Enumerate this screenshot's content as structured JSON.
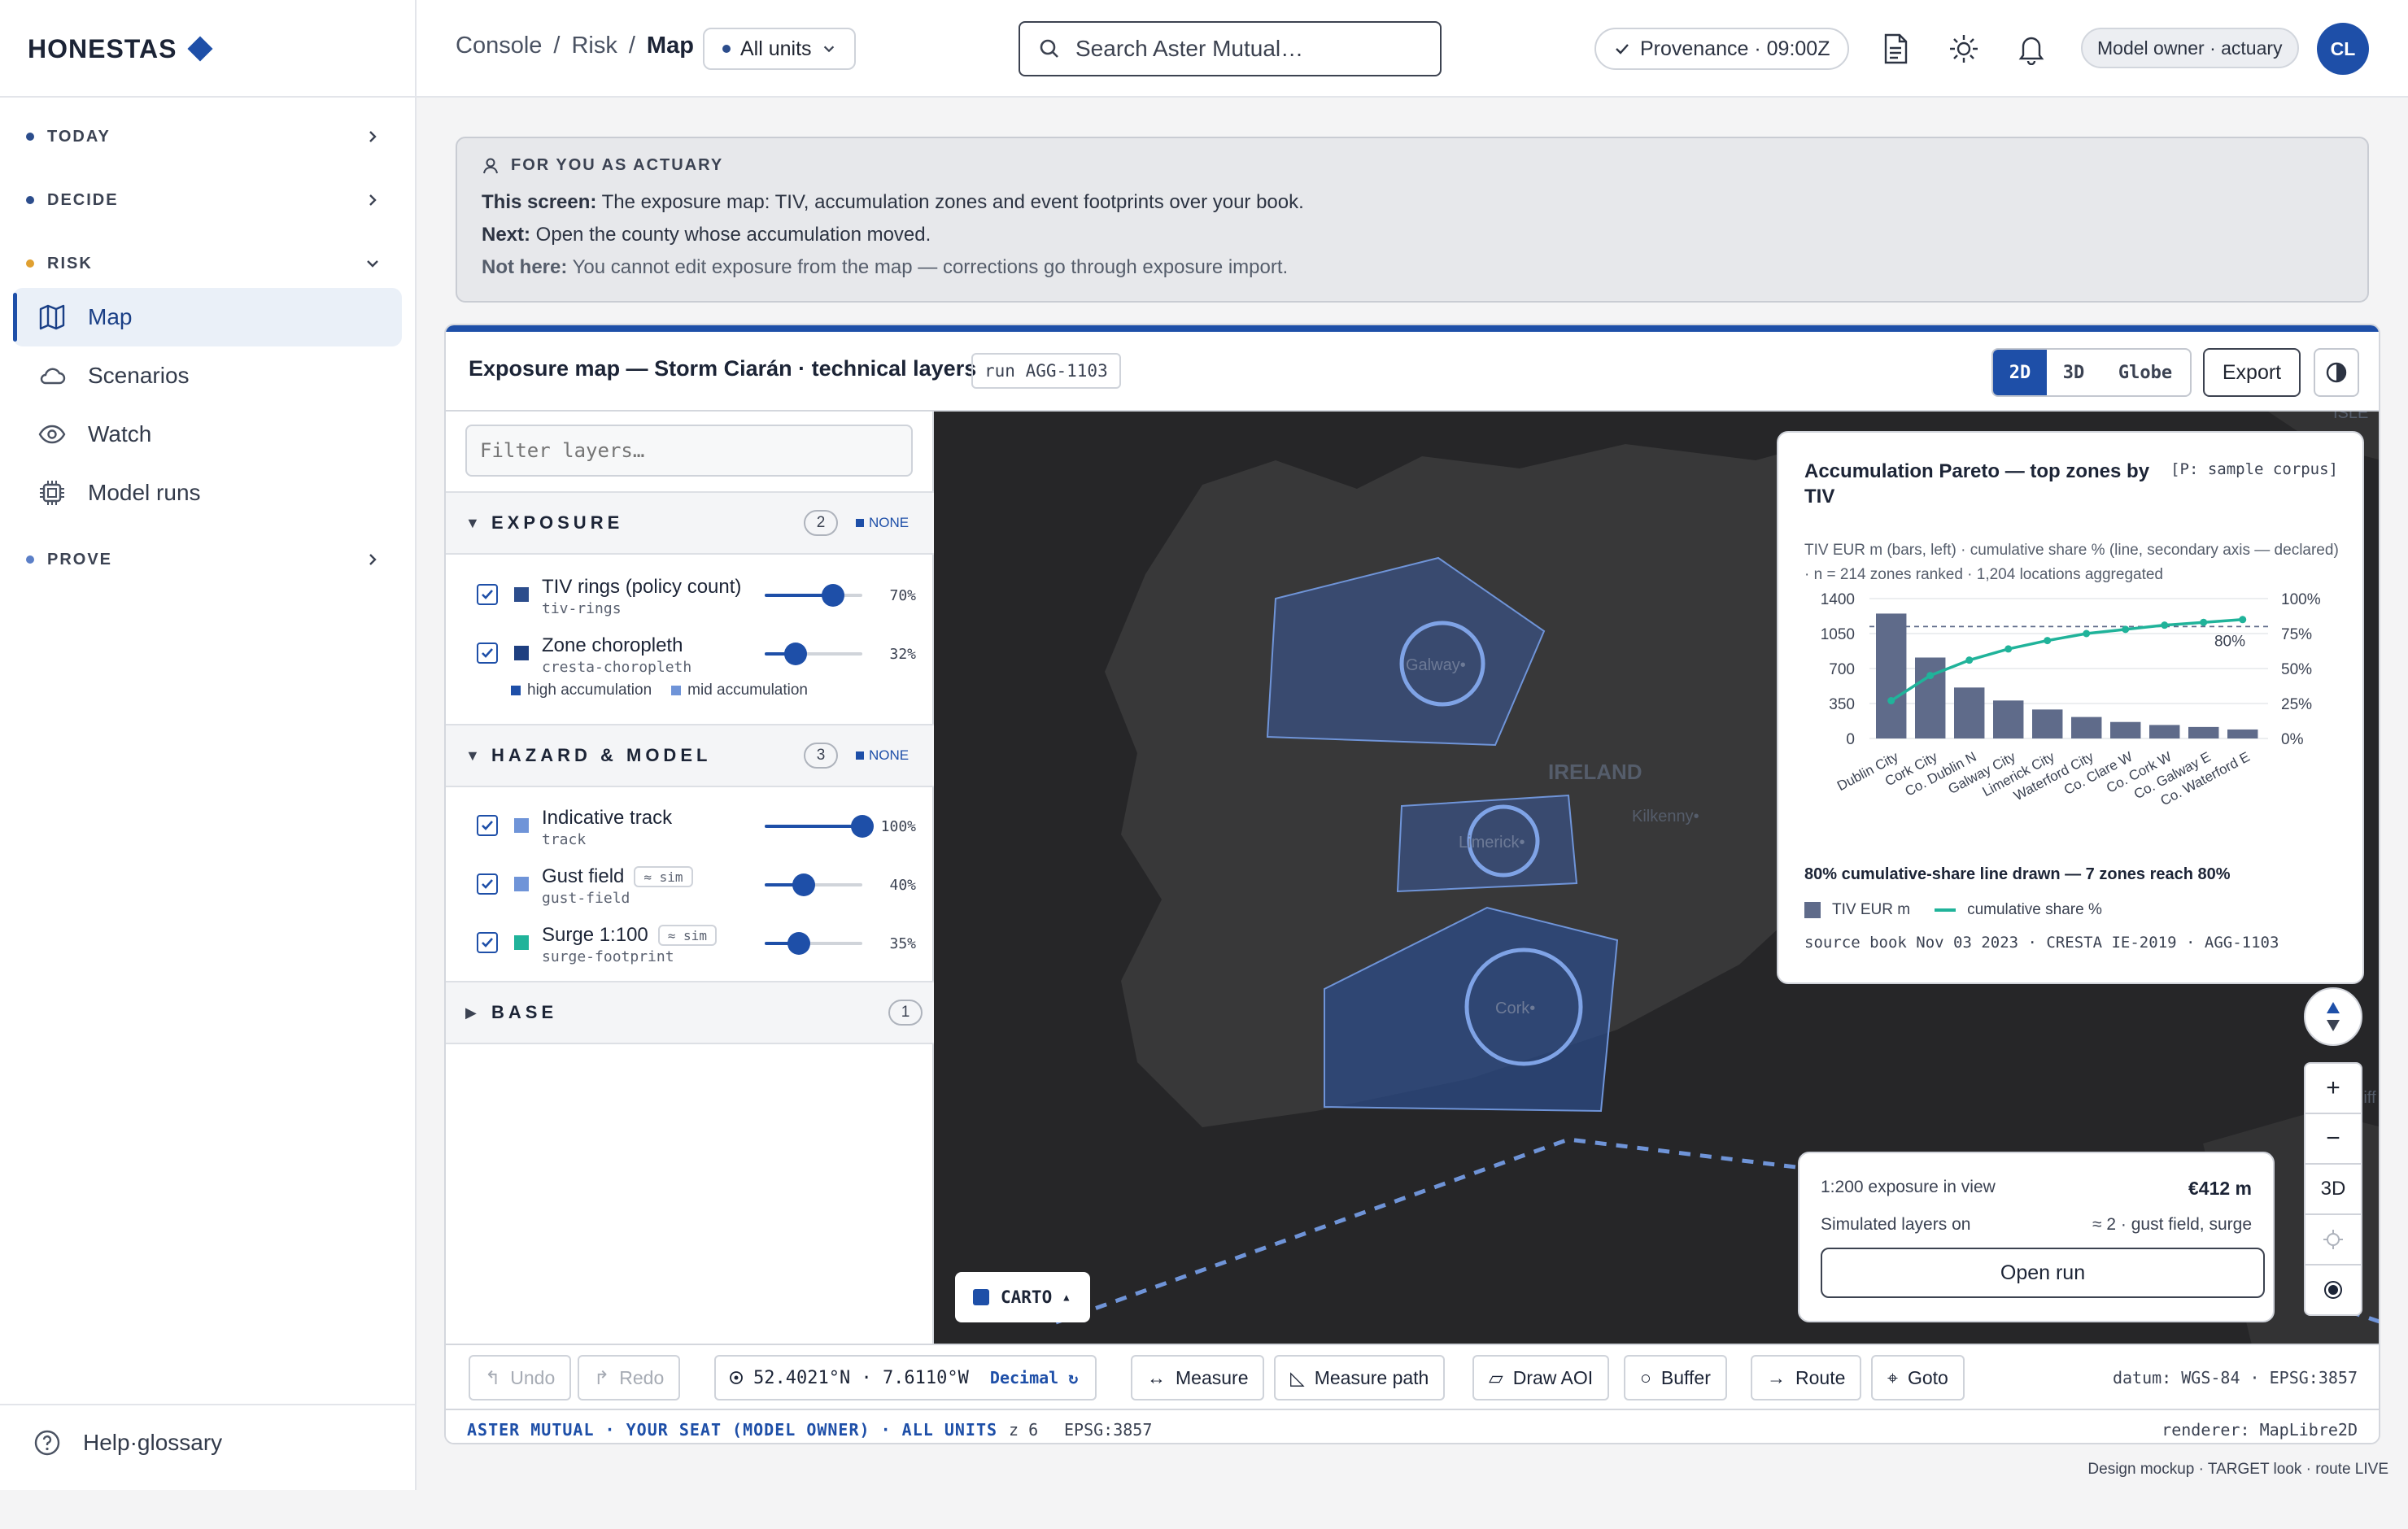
{
  "brand": {
    "name": "HONESTAS"
  },
  "sidebar": {
    "sections": [
      {
        "label": "TODAY",
        "dot_color": "#2c4d8c"
      },
      {
        "label": "DECIDE",
        "dot_color": "#2c4d8c"
      },
      {
        "label": "RISK",
        "dot_color": "#e0a030"
      },
      {
        "label": "PROVE",
        "dot_color": "#5b7fc7"
      }
    ],
    "items": [
      {
        "label": "Map",
        "icon": "map-icon",
        "active": true
      },
      {
        "label": "Scenarios",
        "icon": "cloud-icon"
      },
      {
        "label": "Watch",
        "icon": "eye-icon"
      },
      {
        "label": "Model runs",
        "icon": "chip-icon"
      }
    ],
    "help": "Help·glossary"
  },
  "header": {
    "breadcrumb": [
      "Console",
      "/",
      "Risk",
      "/",
      "Map"
    ],
    "units": "All units",
    "search_placeholder": "Search Aster Mutual…",
    "provenance": "Provenance · 09:00Z",
    "role": "Model owner · actuary",
    "avatar": "CL"
  },
  "info": {
    "heading": "FOR YOU AS ACTUARY",
    "lines": [
      {
        "label": "This screen:",
        "text": " The exposure map: TIV, accumulation zones and event footprints over your book."
      },
      {
        "label": "Next:",
        "text": " Open the county whose accumulation moved."
      },
      {
        "label": "Not here:",
        "text": " You cannot edit exposure from the map — corrections go through exposure import."
      }
    ]
  },
  "card": {
    "title": "Exposure map — Storm Ciarán · technical layers",
    "run": "run AGG-1103",
    "views": [
      "2D",
      "3D",
      "Globe"
    ],
    "active_view": "2D",
    "export": "Export"
  },
  "layers": {
    "filter_placeholder": "Filter layers…",
    "groups": [
      {
        "name": "EXPOSURE",
        "count": "2",
        "none": "NONE",
        "expanded": true
      },
      {
        "name": "HAZARD & MODEL",
        "count": "3",
        "none": "NONE",
        "expanded": true
      },
      {
        "name": "BASE",
        "count": "1",
        "expanded": false
      }
    ],
    "exposure": [
      {
        "name": "TIV rings (policy count)",
        "id": "tiv-rings",
        "opacity": 70,
        "pct": "70%",
        "color": "#2c4d8c"
      },
      {
        "name": "Zone choropleth",
        "id": "cresta-choropleth",
        "opacity": 32,
        "pct": "32%",
        "color": "#1e3f80"
      }
    ],
    "exposure_legend": [
      {
        "label": "high accumulation",
        "color": "#1e4fa8"
      },
      {
        "label": "mid accumulation",
        "color": "#6f94d8"
      }
    ],
    "hazard": [
      {
        "name": "Indicative track",
        "id": "track",
        "opacity": 100,
        "pct": "100%",
        "color": "#6f94d8"
      },
      {
        "name": "Gust field",
        "id": "gust-field",
        "opacity": 40,
        "pct": "40%",
        "color": "#6f94d8",
        "badge": "≈ sim"
      },
      {
        "name": "Surge 1:100",
        "id": "surge-footprint",
        "opacity": 35,
        "pct": "35%",
        "color": "#20b39a",
        "badge": "≈ sim"
      }
    ]
  },
  "map": {
    "labels": {
      "galway": "Galway•",
      "limerick": "Limerick•",
      "cork": "Cork•",
      "ireland": "IRELAND",
      "kilkenny": "Kilkenny•",
      "cardiff": "Cardiff",
      "isle": "ISLE"
    },
    "carto": "CARTO",
    "controls": {
      "zoom_in": "+",
      "zoom_out": "−",
      "threed": "3D"
    }
  },
  "pareto": {
    "title": "Accumulation Pareto — top zones by TIV",
    "tag": "[P: sample corpus]",
    "subtitle": "TIV EUR m (bars, left) · cumulative share % (line, secondary axis — declared) · n = 214 zones ranked · 1,204 locations aggregated",
    "note": "80% cumulative-share line drawn — 7 zones reach 80%",
    "legend_bar": "TIV EUR m",
    "legend_line": "cumulative share %",
    "source": "source book Nov 03 2023 · CRESTA IE-2019 · AGG-1103"
  },
  "chart_data": {
    "type": "bar",
    "categories": [
      "Dublin City",
      "Cork City",
      "Co. Dublin N",
      "Galway City",
      "Limerick City",
      "Waterford City",
      "Co. Clare W",
      "Co. Cork W",
      "Co. Galway E",
      "Co. Waterford E"
    ],
    "series": [
      {
        "name": "TIV EUR m",
        "values": [
          1250,
          810,
          510,
          380,
          290,
          215,
          165,
          135,
          115,
          90
        ],
        "axis": "left"
      },
      {
        "name": "cumulative share %",
        "values": [
          27,
          45,
          56,
          64,
          70,
          75,
          78,
          81,
          83,
          85
        ],
        "axis": "right"
      }
    ],
    "y_ticks": [
      "1400",
      "1050",
      "700",
      "350",
      "0"
    ],
    "y2_ticks": [
      "100%",
      "75%",
      "50%",
      "25%",
      "0%"
    ],
    "ylim": [
      0,
      1400
    ],
    "y2lim": [
      0,
      100
    ],
    "reference_line": {
      "value": 80,
      "label": "80%"
    },
    "bar_color": "#5f6b8a",
    "line_color": "#20b39a"
  },
  "exposure_box": {
    "label": "1:200 exposure in view",
    "value": "€412 m",
    "sim_label": "Simulated layers on",
    "sim_value": "≈ 2 · gust field, surge",
    "button": "Open run"
  },
  "toolbar": {
    "undo": "Undo",
    "redo": "Redo",
    "coord": "52.4021°N · 7.6110°W",
    "format": "Decimal ↻",
    "tools": [
      "Measure",
      "Measure path",
      "Draw AOI",
      "Buffer",
      "Route",
      "Goto"
    ],
    "datum": "datum: WGS-84 · EPSG:3857"
  },
  "statusbar": {
    "left": "ASTER MUTUAL · YOUR SEAT (MODEL OWNER) · ALL UNITS",
    "zoom": "z 6",
    "epsg": "EPSG:3857",
    "renderer": "renderer: MapLibre2D"
  },
  "footer": "Design mockup · TARGET look · route LIVE"
}
